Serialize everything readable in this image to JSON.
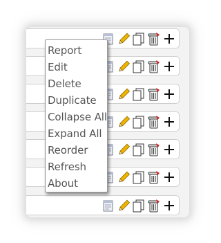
{
  "context_menu": {
    "items": [
      {
        "label": "Report"
      },
      {
        "label": "Edit"
      },
      {
        "label": "Delete"
      },
      {
        "label": "Duplicate"
      },
      {
        "label": "Collapse All"
      },
      {
        "label": "Expand All"
      },
      {
        "label": "Reorder"
      },
      {
        "label": "Refresh"
      },
      {
        "label": "About"
      }
    ]
  },
  "row_actions": {
    "icons": [
      "report-icon",
      "edit-pencil-icon",
      "duplicate-icon",
      "delete-trash-icon",
      "add-plus-icon"
    ]
  },
  "colors": {
    "pencil": "#f0b400",
    "trash_red": "#d42020",
    "menu_text": "#555555"
  }
}
